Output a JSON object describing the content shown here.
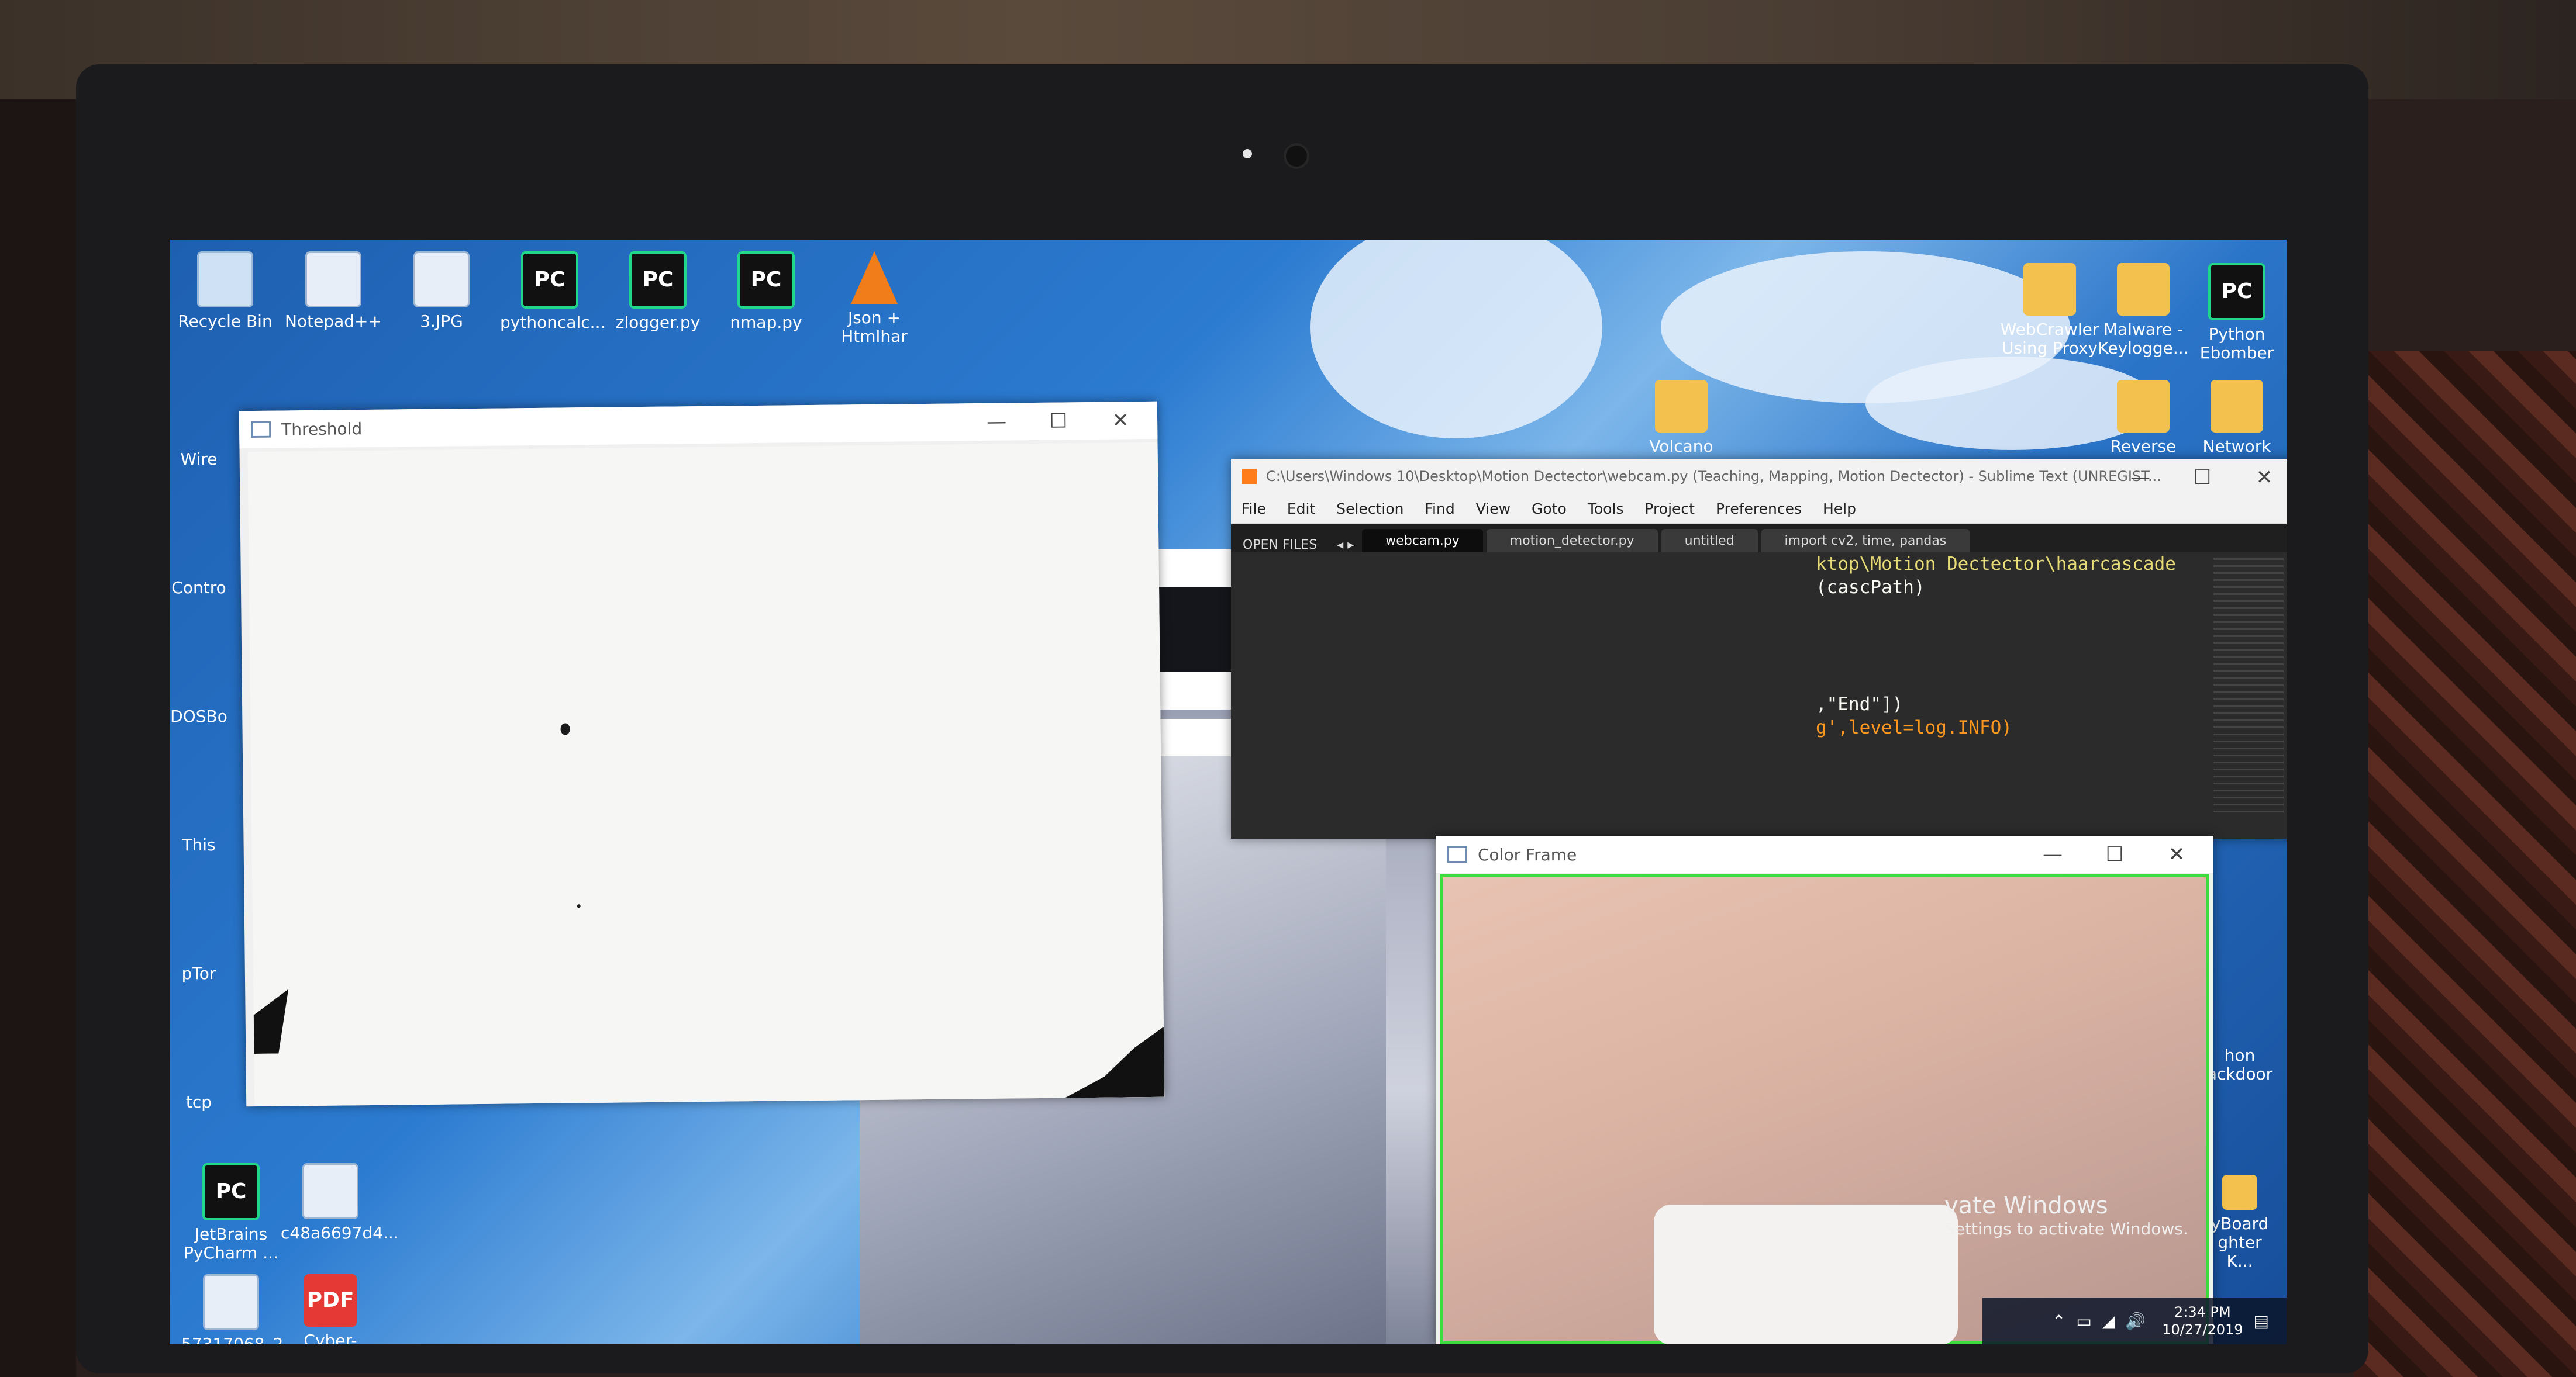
{
  "desktop": {
    "icons_top": [
      {
        "label": "Recycle Bin",
        "kind": "recycle"
      },
      {
        "label": "Notepad++",
        "kind": "img"
      },
      {
        "label": "3.JPG",
        "kind": "img"
      },
      {
        "label": "pythoncalc...",
        "kind": "pc"
      },
      {
        "label": "zlogger.py",
        "kind": "pc"
      },
      {
        "label": "nmap.py",
        "kind": "pc"
      },
      {
        "label": "Json + Htmlhar",
        "kind": "cone"
      }
    ],
    "icons_left": [
      {
        "label": "Wire"
      },
      {
        "label": "Contro"
      },
      {
        "label": "DOSBo"
      },
      {
        "label": "This"
      },
      {
        "label": "pTor"
      },
      {
        "label": "tcp"
      }
    ],
    "icons_bottom_left": [
      {
        "label": "JetBrains PyCharm ...",
        "kind": "pc"
      },
      {
        "label": "c48a6697d4...",
        "kind": "img"
      },
      {
        "label": "57317068_2...",
        "kind": "img"
      },
      {
        "label": "Cyber-Han...",
        "kind": "pdf",
        "glyph": "PDF"
      }
    ],
    "icons_right": [
      {
        "label": "WebCrawler Using Proxy",
        "kind": "folder"
      },
      {
        "label": "Malware - Keylogge...",
        "kind": "folder"
      },
      {
        "label": "Python Ebomber",
        "kind": "pc"
      },
      {
        "label": "Volcano",
        "kind": "folder"
      },
      {
        "label": "Reverse",
        "kind": "folder"
      },
      {
        "label": "Network",
        "kind": "folder"
      },
      {
        "label": "hon",
        "kind": "folder"
      },
      {
        "label": "ackdoor",
        "kind": "folder"
      },
      {
        "label": "yBoard ghter K...",
        "kind": "folder"
      }
    ]
  },
  "threshold_window": {
    "title": "Threshold",
    "minimize": "—",
    "maximize": "☐",
    "close": "✕"
  },
  "sublime_window": {
    "title": "C:\\Users\\Windows 10\\Desktop\\Motion Dectector\\webcam.py (Teaching, Mapping, Motion Dectector) - Sublime Text (UNREGIST...",
    "menu": [
      "File",
      "Edit",
      "Selection",
      "Find",
      "View",
      "Goto",
      "Tools",
      "Project",
      "Preferences",
      "Help"
    ],
    "sidebar_header": "OPEN FILES",
    "tabs": [
      "webcam.py",
      "motion_detector.py",
      "untitled",
      "import cv2, time, pandas"
    ],
    "code_lines": [
      "ktop\\Motion Dectector\\haarcascade",
      "",
      "(cascPath)",
      "",
      "",
      "",
      "",
      ",\"End\"])",
      "g',level=log.INFO)"
    ]
  },
  "color_frame_window": {
    "title": "Color Frame"
  },
  "activation": {
    "title": "vate Windows",
    "subtitle": "Settings to activate Windows."
  },
  "taskbar": {
    "time": "2:34 PM",
    "date": "10/27/2019",
    "tray_icons": [
      "chevron-up-icon",
      "battery-icon",
      "network-icon",
      "volume-icon",
      "notification-icon"
    ]
  }
}
